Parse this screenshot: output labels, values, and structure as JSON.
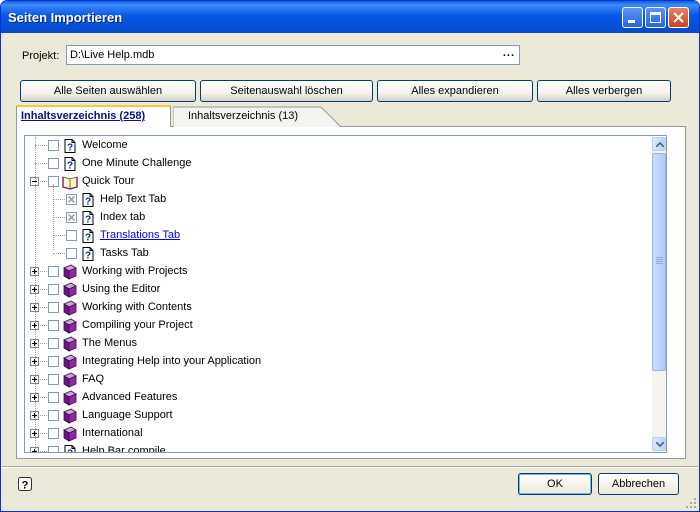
{
  "window": {
    "title": "Seiten Importieren"
  },
  "project": {
    "label": "Projekt:",
    "value": "D:\\Live Help.mdb",
    "browse": "..."
  },
  "toolbar": {
    "select_all": "Alle Seiten auswählen",
    "clear_selection": "Seitenauswahl löschen",
    "expand_all": "Alles expandieren",
    "collapse_all": "Alles verbergen"
  },
  "tabs": [
    {
      "label": "Inhaltsverzeichnis (258)",
      "active": true
    },
    {
      "label": "Inhaltsverzeichnis (13)",
      "active": false
    }
  ],
  "tree": {
    "items": [
      {
        "label": "Welcome",
        "level": 0,
        "icon": "help-page-icon",
        "expander": "none",
        "checked": "none"
      },
      {
        "label": "One Minute Challenge",
        "level": 0,
        "icon": "help-page-icon",
        "expander": "none",
        "checked": "none"
      },
      {
        "label": "Quick Tour",
        "level": 0,
        "icon": "open-book-icon",
        "expander": "minus",
        "checked": "none"
      },
      {
        "label": "Help Text Tab",
        "level": 1,
        "icon": "help-page-icon",
        "expander": "none",
        "checked": "disabled"
      },
      {
        "label": "Index tab",
        "level": 1,
        "icon": "help-page-icon",
        "expander": "none",
        "checked": "disabled"
      },
      {
        "label": "Translations Tab",
        "level": 1,
        "icon": "help-page-icon",
        "expander": "none",
        "checked": "none",
        "link": true
      },
      {
        "label": "Tasks Tab",
        "level": 1,
        "icon": "help-page-icon",
        "expander": "none",
        "checked": "none"
      },
      {
        "label": "Working with Projects",
        "level": 0,
        "icon": "book-icon",
        "expander": "plus",
        "checked": "none"
      },
      {
        "label": "Using the Editor",
        "level": 0,
        "icon": "book-icon",
        "expander": "plus",
        "checked": "none"
      },
      {
        "label": "Working with Contents",
        "level": 0,
        "icon": "book-icon",
        "expander": "plus",
        "checked": "none"
      },
      {
        "label": "Compiling your Project",
        "level": 0,
        "icon": "book-icon",
        "expander": "plus",
        "checked": "none"
      },
      {
        "label": "The Menus",
        "level": 0,
        "icon": "book-icon",
        "expander": "plus",
        "checked": "none"
      },
      {
        "label": "Integrating Help into your Application",
        "level": 0,
        "icon": "book-icon",
        "expander": "plus",
        "checked": "none"
      },
      {
        "label": "FAQ",
        "level": 0,
        "icon": "book-icon",
        "expander": "plus",
        "checked": "none"
      },
      {
        "label": "Advanced Features",
        "level": 0,
        "icon": "book-icon",
        "expander": "plus",
        "checked": "none"
      },
      {
        "label": "Language Support",
        "level": 0,
        "icon": "book-icon",
        "expander": "plus",
        "checked": "none"
      },
      {
        "label": "International",
        "level": 0,
        "icon": "book-icon",
        "expander": "plus",
        "checked": "none"
      },
      {
        "label": "Help Bar compile",
        "level": 0,
        "icon": "help-page-icon",
        "expander": "plus",
        "checked": "none"
      }
    ]
  },
  "buttons": {
    "ok": "OK",
    "cancel": "Abbrechen"
  },
  "colors": {
    "title_bar": "#0454df",
    "tab_highlight": "#ffc83c",
    "book": "#7a1a8c",
    "link": "#0000ee"
  }
}
